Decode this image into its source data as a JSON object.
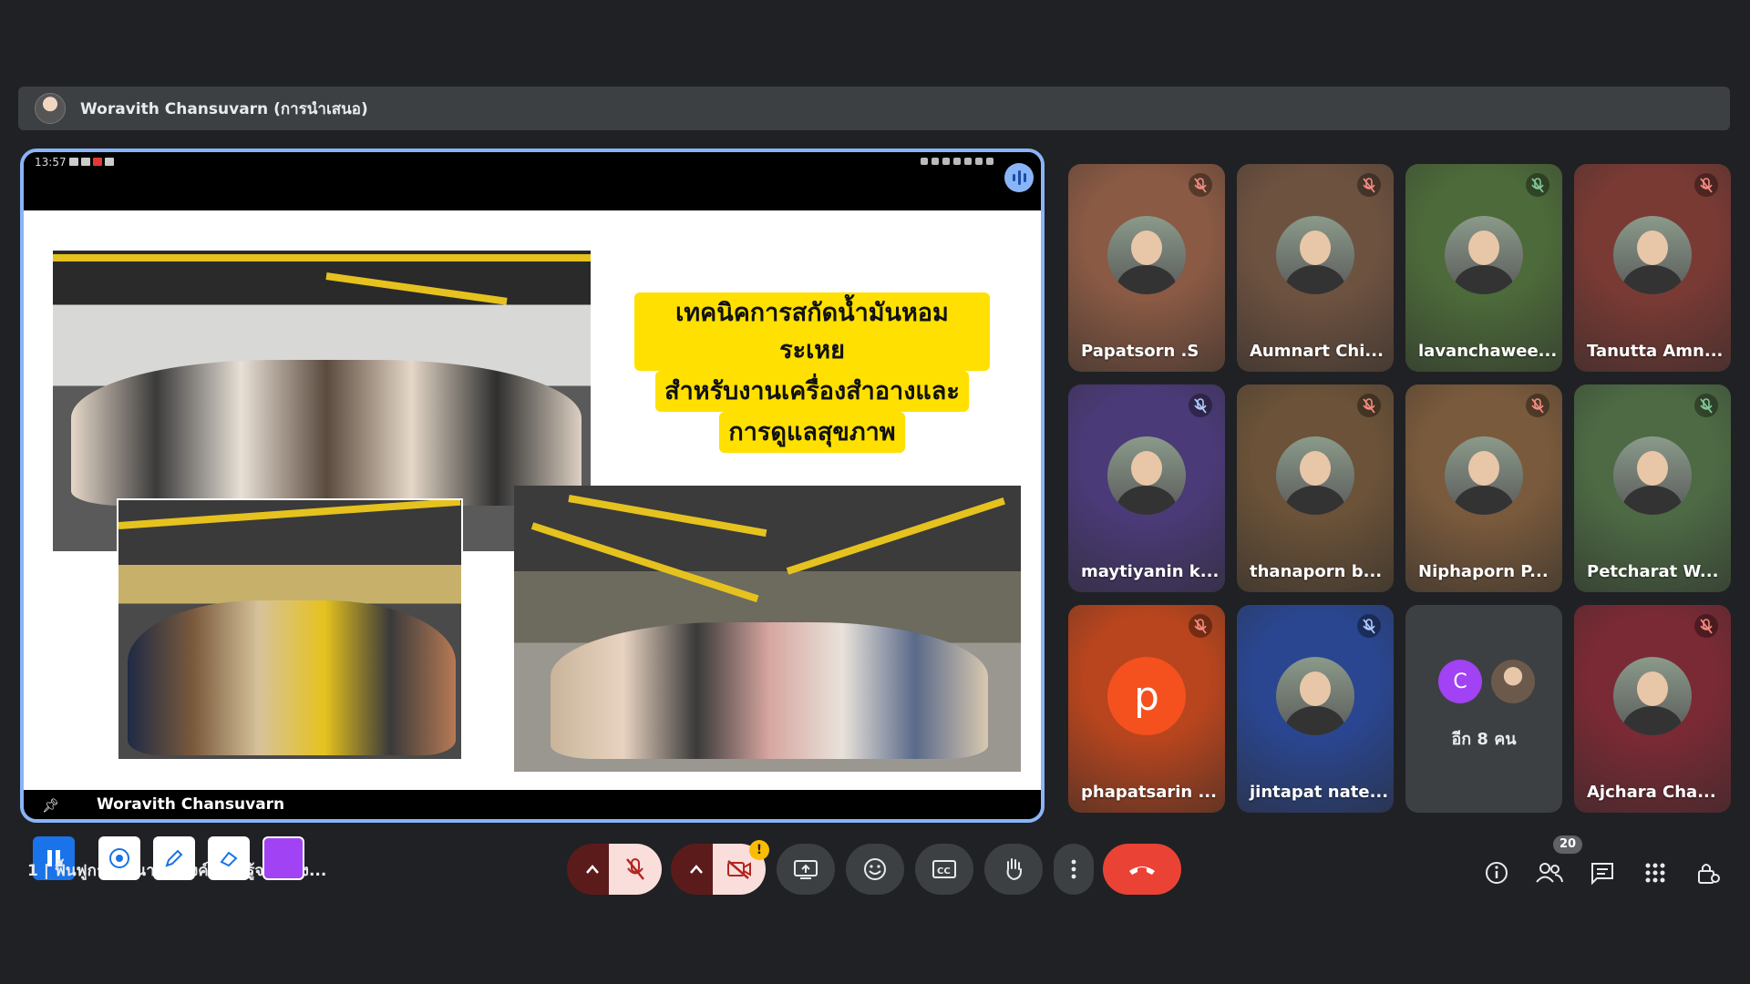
{
  "presenter": {
    "label": "Woravith Chansuvarn (การนำเสนอ)"
  },
  "stage": {
    "status_time": "13:57",
    "slide_title_lines": [
      "เทคนิคการสกัดน้ำมันหอมระเหย",
      "สำหรับงานเครื่องสำอางและ",
      "การดูแลสุขภาพ"
    ],
    "presenter_name": "Woravith Chansuvarn"
  },
  "participants": [
    {
      "name": "Papatsorn .S",
      "bg": "#8a5a44",
      "muted": true
    },
    {
      "name": "Aumnart Chi...",
      "bg": "#6e5240",
      "muted": true
    },
    {
      "name": "lavanchawee...",
      "bg": "#4d6a3a",
      "muted": true
    },
    {
      "name": "Tanutta Amn...",
      "bg": "#7a3a34",
      "muted": true
    },
    {
      "name": "maytiyanin k...",
      "bg": "#4b3a78",
      "muted": true
    },
    {
      "name": "thanaporn b...",
      "bg": "#6b5238",
      "muted": true
    },
    {
      "name": "Niphaporn P...",
      "bg": "#7a5a3c",
      "muted": true
    },
    {
      "name": "Petcharat W...",
      "bg": "#4d6a44",
      "muted": true
    },
    {
      "name": "phapatsarin ...",
      "bg": "#b8451e",
      "muted": true,
      "letter": "p"
    },
    {
      "name": "jintapat nate...",
      "bg": "#2a4690",
      "muted": true
    },
    {
      "name": "อีก 8 คน",
      "bg": "#3c4043",
      "more": true,
      "letter": "C"
    },
    {
      "name": "Ajchara Cha...",
      "bg": "#7a2a34",
      "muted": true
    }
  ],
  "toolbar": {
    "meeting_title": "1 | ฟื้นฟูการบูรณาการองค์ความรู้จากห้อง...",
    "participant_count": "20",
    "icons": [
      "pause-icon",
      "laser-pointer-icon",
      "pen-icon",
      "eraser-icon",
      "color-swatch-icon",
      "chevron-up-icon",
      "mic-off-icon",
      "camera-off-icon",
      "present-icon",
      "emoji-icon",
      "captions-icon",
      "raise-hand-icon",
      "more-options-icon",
      "end-call-icon",
      "info-icon",
      "people-icon",
      "chat-icon",
      "activities-icon",
      "host-controls-icon"
    ]
  },
  "colors": {
    "accent": "#8ab4f8",
    "end_call": "#ea4335",
    "muted_red": "#f28b82",
    "annotation_color": "#a142f4"
  }
}
